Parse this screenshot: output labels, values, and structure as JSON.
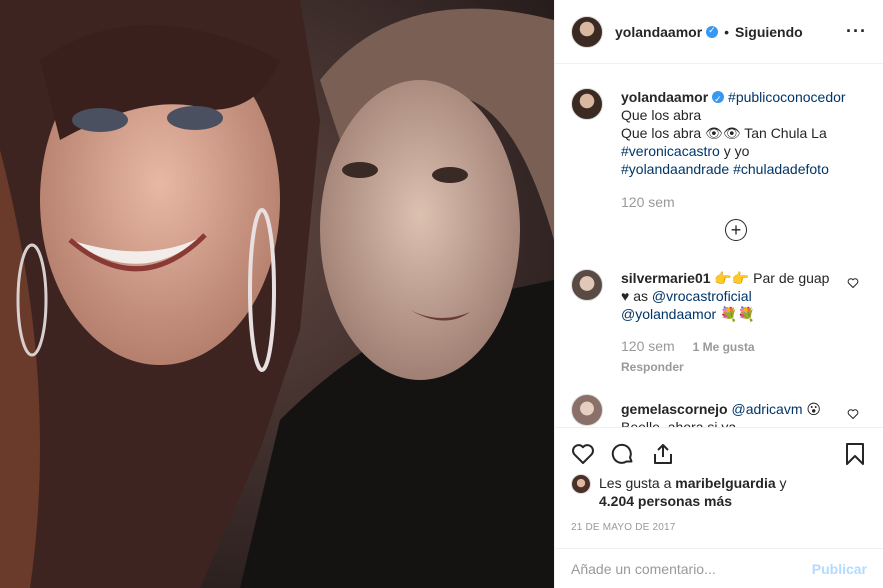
{
  "photo": {
    "alt_icon": "photo"
  },
  "header": {
    "username": "yolandaamor",
    "separator": "•",
    "follow_status": "Siguiendo",
    "more": "···"
  },
  "caption": {
    "username": "yolandaamor",
    "hashtag1": "#publicoconocedor",
    "line1": "Que los abra",
    "line2": "Que los abra 👁👁 Tan Chula La",
    "mention": "#veronicacastro",
    "connector": " y yo",
    "hashtag2": "#yolandaandrade",
    "hashtag3": "#chuladadefoto",
    "time": "120 sem"
  },
  "load_more": "+",
  "comments": [
    {
      "username": "silvermarie01",
      "text": "👉👉 Par de guap ♥ as ",
      "mention1": "@vrocastroficial",
      "mention2": "@yolandaamor",
      "emoji_end": " 💐💐",
      "time": "120 sem",
      "likes": "1 Me gusta",
      "reply": "Responder"
    },
    {
      "username": "gemelascornejo",
      "mention1": "@adricavm",
      "emoji_end": " 😮",
      "partial": "Beelle, ahora si ya"
    }
  ],
  "likes": {
    "prefix": "Les gusta a ",
    "user": "maribelguardia",
    "and": " y",
    "count": "4.204 personas más"
  },
  "date": "21 DE MAYO DE 2017",
  "add_comment": {
    "placeholder": "Añade un comentario...",
    "publish": "Publicar"
  },
  "colors": {
    "link": "#003569",
    "muted": "#999999",
    "publish_disabled": "#b3dbff",
    "verified": "#3897f0"
  }
}
